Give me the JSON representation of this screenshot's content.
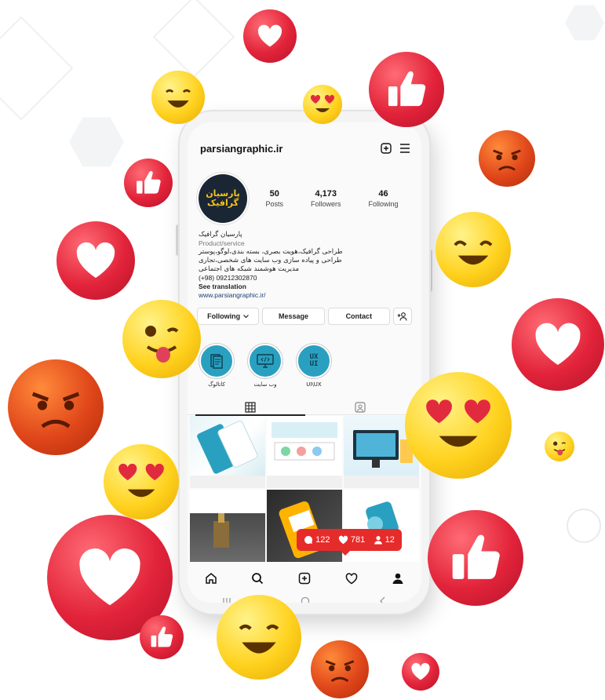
{
  "profile": {
    "username": "parsiangraphic.ir",
    "avatar_text": "پارسیان گرافیک",
    "stats": [
      {
        "value": "50",
        "label": "Posts"
      },
      {
        "value": "4,173",
        "label": "Followers"
      },
      {
        "value": "46",
        "label": "Following"
      }
    ],
    "name": "پارسیان گرافیک",
    "category": "Product/service",
    "bio_lines": [
      "طراحی گرافیک،هویت بصری، بسته بندی،لوگو،پوستر",
      "طراحی و پیاده سازی وب سایت های شخصی،تجاری",
      "مدیریت هوشمند شبکه های اجتماعی"
    ],
    "phone": "(+98) 09212302870",
    "see_translation": "See translation",
    "website": "www.parsiangraphic.ir/"
  },
  "buttons": {
    "following": "Following",
    "message": "Message",
    "contact": "Contact"
  },
  "highlights": [
    {
      "label": "کاتالوگ",
      "icon": "catalog-icon"
    },
    {
      "label": "وب سایت",
      "icon": "monitor-code-icon"
    },
    {
      "label": "UI\\UX",
      "icon": "uxui-icon"
    }
  ],
  "highlight_uxui_text": "UX\nUI",
  "notifications": {
    "comments": "122",
    "likes": "781",
    "followers": "12"
  },
  "colors": {
    "notification_red": "#e62b2b",
    "highlight_blue": "#2aa0c0",
    "avatar_bg": "#1b2635",
    "avatar_gold": "#f5c518"
  }
}
